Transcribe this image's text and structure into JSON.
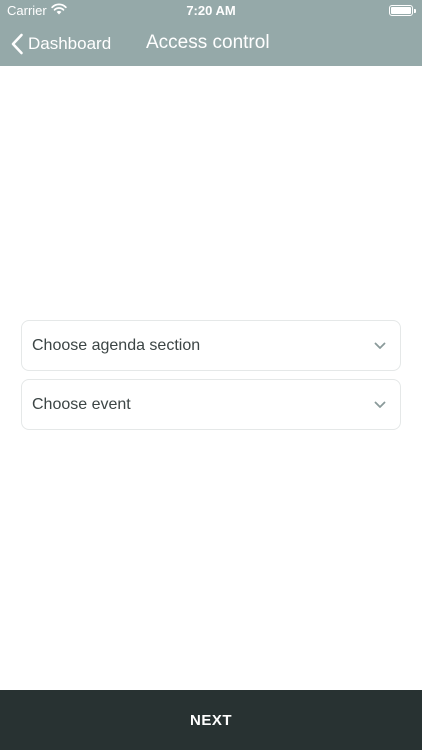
{
  "status_bar": {
    "carrier": "Carrier",
    "time": "7:20 AM",
    "wifi_icon": "wifi-icon",
    "battery_icon": "battery-icon",
    "battery_level": 1.0
  },
  "nav": {
    "back_label": "Dashboard",
    "back_icon": "chevron-left-icon",
    "title": "Access control"
  },
  "form": {
    "agenda_select": {
      "placeholder": "Choose agenda section",
      "icon": "chevron-down-icon"
    },
    "event_select": {
      "placeholder": "Choose event",
      "icon": "chevron-down-icon"
    }
  },
  "footer": {
    "next_label": "NEXT"
  },
  "colors": {
    "nav_background": "#95a9a9",
    "footer_background": "#283232",
    "select_border": "#e5e8e8",
    "text_dark": "#3c4545",
    "caret": "#8a9a9a"
  }
}
